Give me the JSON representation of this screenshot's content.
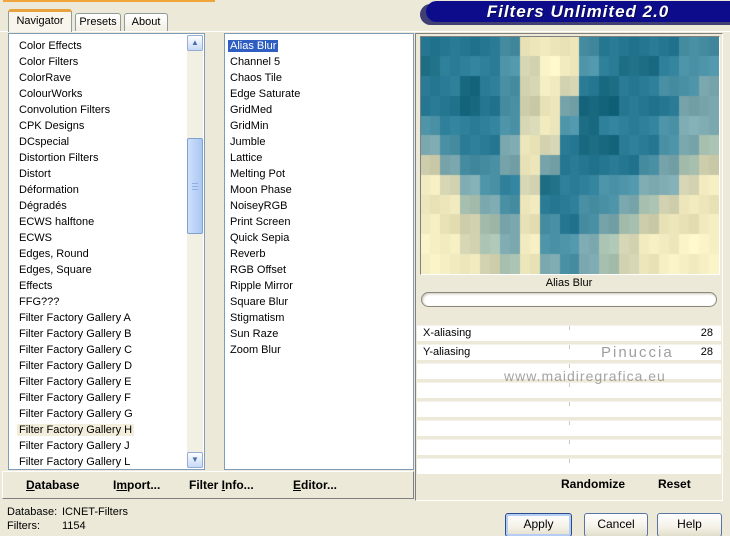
{
  "window": {
    "title_banner": "Filters Unlimited 2.0"
  },
  "tabs": [
    {
      "label": "Navigator",
      "active": true
    },
    {
      "label": "Presets",
      "active": false
    },
    {
      "label": "About",
      "active": false
    }
  ],
  "category_list": {
    "items": [
      "Color Effects",
      "Color Filters",
      "ColorRave",
      "ColourWorks",
      "Convolution Filters",
      "CPK Designs",
      "DCspecial",
      "Distortion Filters",
      "Distort",
      "Déformation",
      "Dégradés",
      "ECWS halftone",
      "ECWS",
      "Edges, Round",
      "Edges, Square",
      "Effects",
      "FFG???",
      "Filter Factory Gallery A",
      "Filter Factory Gallery B",
      "Filter Factory Gallery C",
      "Filter Factory Gallery D",
      "Filter Factory Gallery E",
      "Filter Factory Gallery F",
      "Filter Factory Gallery G",
      "Filter Factory Gallery H",
      "Filter Factory Gallery J",
      "Filter Factory Gallery L"
    ],
    "selected": "Filter Factory Gallery H"
  },
  "filter_list": {
    "items": [
      "Alias Blur",
      "Channel 5",
      "Chaos Tile",
      "Edge Saturate",
      "GridMed",
      "GridMin",
      "Jumble",
      "Lattice",
      "Melting Pot",
      "Moon Phase",
      "NoiseyRGB",
      "Print Screen",
      "Quick Sepia",
      "Reverb",
      "RGB Offset",
      "Ripple Mirror",
      "Square Blur",
      "Stigmatism",
      "Sun Raze",
      "Zoom Blur"
    ],
    "selected": "Alias Blur"
  },
  "preview": {
    "caption": "Alias Blur",
    "watermark_line1": "Pinuccia",
    "watermark_line2": "www.maidiregrafica.eu",
    "palette": {
      "A": "#186880",
      "B": "#2a7b96",
      "C": "#4a90a5",
      "D": "#7aa8ae",
      "E": "#a6bfae",
      "F": "#d2d2b0",
      "G": "#ece6ba",
      "H": "#f6efc4"
    },
    "grid": [
      "BBBBCGHGCBBBBCC",
      "ABBBCFHGCBAABCC",
      "BBABCFHFBABBCCD",
      "BBABCFGDAABBBDD",
      "CBBBCFGCABBBCDD",
      "DCBBDGFBAABBCDE",
      "FDCCDGDBBBBCDEF",
      "GFDCBFABBCCDDFG",
      "GGEDCGBBCCDEFGG",
      "HGFEDGCBCDEFGGH",
      "HGFEDGCCDEFGGHH",
      "HHGFEGDCDEFGHHH"
    ]
  },
  "controls": {
    "sliders": [
      {
        "label": "X-aliasing",
        "value": "28"
      },
      {
        "label": "Y-aliasing",
        "value": "28"
      }
    ],
    "empty_rows": 6,
    "randomize_label": "Randomize",
    "reset_label": "Reset"
  },
  "toolbar": {
    "database": {
      "label": "Database",
      "accel": 0
    },
    "import": {
      "label": "Import...",
      "accel": 1
    },
    "filter_info": {
      "label": "Filter Info...",
      "accel": 7
    },
    "editor": {
      "label": "Editor...",
      "accel": 0
    }
  },
  "status": {
    "database_label": "Database:",
    "database_value": "ICNET-Filters",
    "filters_label": "Filters:",
    "filters_value": "1154"
  },
  "action_buttons": {
    "apply": "Apply",
    "cancel": "Cancel",
    "help": "Help"
  },
  "colors": {
    "dialog_bg": "#ece9d8",
    "banner_navy": "#0d0d8c",
    "selection_blue": "#2e5ec1",
    "inactive_selection": "#f2eedb",
    "tab_accent_orange": "#e8a33c"
  }
}
